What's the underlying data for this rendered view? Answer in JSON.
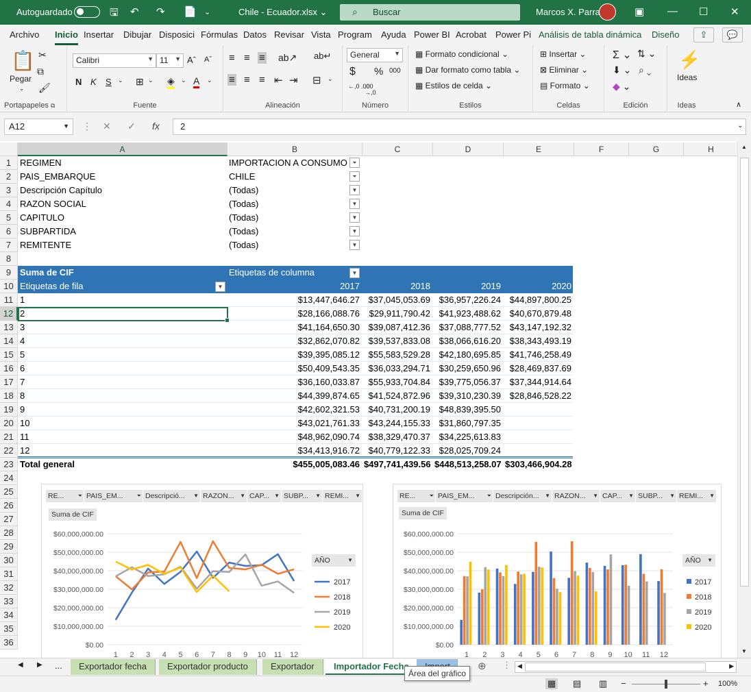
{
  "titlebar": {
    "autosave_label": "Autoguardado",
    "doc_title": "Chile - Ecuador.xlsx",
    "doc_arrow": "⌄",
    "search_placeholder": "Buscar",
    "user_name": "Marcos X. Parra"
  },
  "tabs": [
    "Archivo",
    "Inicio",
    "Insertar",
    "Dibujar",
    "Disposici",
    "Fórmulas",
    "Datos",
    "Revisar",
    "Vista",
    "Program",
    "Ayuda",
    "Power BI",
    "Acrobat",
    "Power Pi",
    "Análisis de tabla dinámica",
    "Diseño"
  ],
  "ribbon": {
    "clipboard": {
      "paste": "Pegar",
      "label": "Portapapeles"
    },
    "font": {
      "name": "Calibri",
      "size": "11",
      "bold": "N",
      "italic": "K",
      "underline": "S",
      "grow": "A",
      "shrink": "A",
      "label": "Fuente"
    },
    "alignment": {
      "label": "Alineación"
    },
    "number": {
      "format": "General",
      "label": "Número",
      "currency": "$",
      "percent": "%",
      "thousands": "000",
      "inc_dec": "←,0 .00",
      "dec_dec": ".00 →,0"
    },
    "styles": {
      "cond": "Formato condicional",
      "table": "Dar formato como tabla",
      "cell": "Estilos de celda",
      "label": "Estilos"
    },
    "cells": {
      "insert": "Insertar",
      "delete": "Eliminar",
      "format": "Formato",
      "label": "Celdas"
    },
    "editing": {
      "label": "Edición"
    },
    "ideas": {
      "btn": "Ideas",
      "label": "Ideas"
    }
  },
  "formula": {
    "namebox": "A12",
    "value": "2",
    "fx": "fx"
  },
  "columns": [
    "A",
    "B",
    "C",
    "D",
    "E",
    "F",
    "G",
    "H"
  ],
  "rows": [
    "1",
    "2",
    "3",
    "4",
    "5",
    "6",
    "7",
    "8",
    "9",
    "10",
    "11",
    "12",
    "13",
    "14",
    "15",
    "16",
    "17",
    "18",
    "19",
    "20",
    "21",
    "22",
    "23",
    "24",
    "25",
    "26",
    "27",
    "28",
    "29",
    "30",
    "31",
    "32",
    "33",
    "34",
    "35",
    "36"
  ],
  "filters": [
    {
      "label": "REGIMEN",
      "value": "IMPORTACION A CONSUMO"
    },
    {
      "label": "PAIS_EMBARQUE",
      "value": "CHILE"
    },
    {
      "label": "Descripción Capítulo",
      "value": "(Todas)"
    },
    {
      "label": "RAZON SOCIAL",
      "value": "(Todas)"
    },
    {
      "label": "CAPITULO",
      "value": "(Todas)"
    },
    {
      "label": "SUBPARTIDA",
      "value": "(Todas)"
    },
    {
      "label": "REMITENTE",
      "value": "(Todas)"
    }
  ],
  "pivot": {
    "value_label": "Suma de CIF",
    "col_label": "Etiquetas de columna",
    "row_label": "Etiquetas de fila",
    "years": [
      "2017",
      "2018",
      "2019",
      "2020"
    ],
    "rows": [
      {
        "k": "1",
        "v": [
          "$13,447,646.27",
          "$37,045,053.69",
          "$36,957,226.24",
          "$44,897,800.25"
        ]
      },
      {
        "k": "2",
        "v": [
          "$28,166,088.76",
          "$29,911,790.42",
          "$41,923,488.62",
          "$40,670,879.48"
        ]
      },
      {
        "k": "3",
        "v": [
          "$41,164,650.30",
          "$39,087,412.36",
          "$37,088,777.52",
          "$43,147,192.32"
        ]
      },
      {
        "k": "4",
        "v": [
          "$32,862,070.82",
          "$39,537,833.08",
          "$38,066,616.20",
          "$38,343,493.19"
        ]
      },
      {
        "k": "5",
        "v": [
          "$39,395,085.12",
          "$55,583,529.28",
          "$42,180,695.85",
          "$41,746,258.49"
        ]
      },
      {
        "k": "6",
        "v": [
          "$50,409,543.35",
          "$36,033,294.71",
          "$30,259,650.96",
          "$28,469,837.69"
        ]
      },
      {
        "k": "7",
        "v": [
          "$36,160,033.87",
          "$55,933,704.84",
          "$39,775,056.37",
          "$37,344,914.64"
        ]
      },
      {
        "k": "8",
        "v": [
          "$44,399,874.65",
          "$41,524,872.96",
          "$39,310,230.39",
          "$28,846,528.22"
        ]
      },
      {
        "k": "9",
        "v": [
          "$42,602,321.53",
          "$40,731,200.19",
          "$48,839,395.50",
          ""
        ]
      },
      {
        "k": "10",
        "v": [
          "$43,021,761.33",
          "$43,244,155.33",
          "$31,860,797.35",
          ""
        ]
      },
      {
        "k": "11",
        "v": [
          "$48,962,090.74",
          "$38,329,470.37",
          "$34,225,613.83",
          ""
        ]
      },
      {
        "k": "12",
        "v": [
          "$34,413,916.72",
          "$40,779,122.33",
          "$28,025,709.24",
          ""
        ]
      }
    ],
    "total_label": "Total general",
    "totals": [
      "$455,005,083.46",
      "$497,741,439.56",
      "$448,513,258.07",
      "$303,466,904.28"
    ]
  },
  "chart_filter_buttons": {
    "line": [
      "RE...",
      "PAIS_EM...",
      "Descripció...",
      "RAZON...",
      "CAP...",
      "SUBP...",
      "REMI..."
    ],
    "bar": [
      "RE...",
      "PAIS_EM...",
      "Descripción...",
      "RAZON...",
      "CAP...",
      "SUBP...",
      "REMI..."
    ]
  },
  "chart_colors": {
    "2017": "#4472c4",
    "2018": "#ed7d31",
    "2019": "#a5a5a5",
    "2020": "#ffc000"
  },
  "chart_data": [
    {
      "type": "line",
      "value_field": "Suma de CIF",
      "legend_title": "AÑO",
      "legend_position": "right",
      "categories": [
        "1",
        "2",
        "3",
        "4",
        "5",
        "6",
        "7",
        "8",
        "9",
        "10",
        "11",
        "12"
      ],
      "y_ticks": [
        "$0.00",
        "$10,000,000.00",
        "$20,000,000.00",
        "$30,000,000.00",
        "$40,000,000.00",
        "$50,000,000.00",
        "$60,000,000.00"
      ],
      "ylim": [
        0,
        60000000
      ],
      "series": [
        {
          "name": "2017",
          "values": [
            13447646.27,
            28166088.76,
            41164650.3,
            32862070.82,
            39395085.12,
            50409543.35,
            36160033.87,
            44399874.65,
            42602321.53,
            43021761.33,
            48962090.74,
            34413916.72
          ]
        },
        {
          "name": "2018",
          "values": [
            37045053.69,
            29911790.42,
            39087412.36,
            39537833.08,
            55583529.28,
            36033294.71,
            55933704.84,
            41524872.96,
            40731200.19,
            43244155.33,
            38329470.37,
            40779122.33
          ]
        },
        {
          "name": "2019",
          "values": [
            36957226.24,
            41923488.62,
            37088777.52,
            38066616.2,
            42180695.85,
            30259650.96,
            39775056.37,
            39310230.39,
            48839395.5,
            31860797.35,
            34225613.83,
            28025709.24
          ]
        },
        {
          "name": "2020",
          "values": [
            44897800.25,
            40670879.48,
            43147192.32,
            38343493.19,
            41746258.49,
            28469837.69,
            37344914.64,
            28846528.22
          ]
        }
      ]
    },
    {
      "type": "bar",
      "value_field": "Suma de CIF",
      "legend_title": "AÑO",
      "legend_position": "right",
      "categories": [
        "1",
        "2",
        "3",
        "4",
        "5",
        "6",
        "7",
        "8",
        "9",
        "10",
        "11",
        "12"
      ],
      "y_ticks": [
        "$0.00",
        "$10,000,000.00",
        "$20,000,000.00",
        "$30,000,000.00",
        "$40,000,000.00",
        "$50,000,000.00",
        "$60,000,000.00"
      ],
      "ylim": [
        0,
        60000000
      ],
      "series": [
        {
          "name": "2017",
          "values": [
            13447646.27,
            28166088.76,
            41164650.3,
            32862070.82,
            39395085.12,
            50409543.35,
            36160033.87,
            44399874.65,
            42602321.53,
            43021761.33,
            48962090.74,
            34413916.72
          ]
        },
        {
          "name": "2018",
          "values": [
            37045053.69,
            29911790.42,
            39087412.36,
            39537833.08,
            55583529.28,
            36033294.71,
            55933704.84,
            41524872.96,
            40731200.19,
            43244155.33,
            38329470.37,
            40779122.33
          ]
        },
        {
          "name": "2019",
          "values": [
            36957226.24,
            41923488.62,
            37088777.52,
            38066616.2,
            42180695.85,
            30259650.96,
            39775056.37,
            39310230.39,
            48839395.5,
            31860797.35,
            34225613.83,
            28025709.24
          ]
        },
        {
          "name": "2020",
          "values": [
            44897800.25,
            40670879.48,
            43147192.32,
            38343493.19,
            41746258.49,
            28469837.69,
            37344914.64,
            28846528.22
          ]
        }
      ]
    }
  ],
  "sheet_tabs": {
    "ellipsis": "...",
    "tabs": [
      "Exportador fecha",
      "Exportador producto",
      "Exportador",
      "Importador Fecha",
      "Import"
    ]
  },
  "tooltip": "Área del gráfico",
  "status": {
    "zoom": "100%"
  }
}
